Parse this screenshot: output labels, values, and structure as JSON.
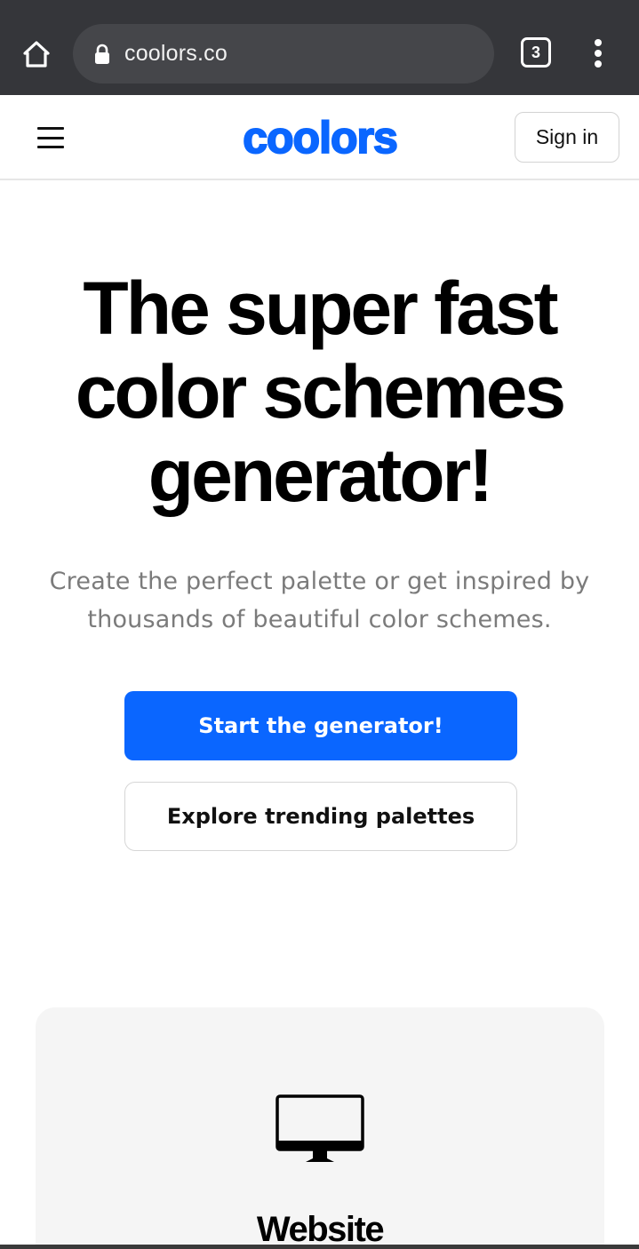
{
  "browser": {
    "url": "coolors.co",
    "tab_count": "3"
  },
  "header": {
    "logo_text": "coolors",
    "sign_in_label": "Sign in"
  },
  "hero": {
    "title_line1": "The super fast",
    "title_line2": "color schemes",
    "title_line3": "generator!",
    "subtitle_line1": "Create the perfect palette or get inspired by",
    "subtitle_line2": "thousands of beautiful color schemes.",
    "primary_button": "Start the generator!",
    "secondary_button": "Explore trending palettes"
  },
  "feature_card": {
    "icon": "monitor-icon",
    "title": "Website"
  },
  "colors": {
    "brand_blue": "#0a66ff",
    "browser_bar": "#35363a",
    "subtitle_gray": "#7b7b7b",
    "card_bg": "#f5f5f5"
  }
}
